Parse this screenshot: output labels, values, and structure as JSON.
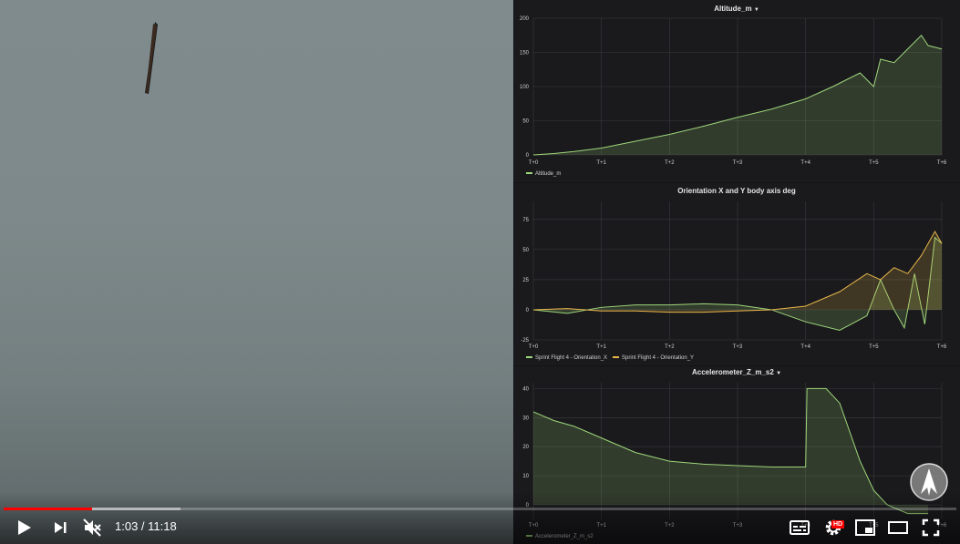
{
  "player": {
    "current_time": "1:03",
    "separator": " / ",
    "duration": "11:18",
    "played_fraction": 0.093,
    "buffered_fraction": 0.186,
    "hd_badge": "HD",
    "icons": [
      "play-icon",
      "next-icon",
      "mute-icon",
      "subtitles-icon",
      "settings-icon",
      "miniplayer-icon",
      "theater-icon",
      "fullscreen-icon"
    ]
  },
  "dashboard": {
    "colors": {
      "bg": "#1a1a1d",
      "grid": "#3a3a3f",
      "green": "#9ed67a",
      "yellow": "#e8b64a",
      "text": "#d0d0d0"
    },
    "panels": [
      {
        "title": "Altitude_m",
        "has_dropdown": true,
        "legend": [
          "Altitude_m"
        ]
      },
      {
        "title": "Orientation X and Y body axis deg",
        "has_dropdown": false,
        "legend": [
          "Sprint Flight 4 - Orientation_X",
          "Sprint Flight 4 - Orientation_Y"
        ]
      },
      {
        "title": "Accelerometer_Z_m_s2",
        "has_dropdown": true,
        "legend": [
          "Accelerometer_Z_m_s2"
        ]
      }
    ]
  },
  "chart_data": [
    {
      "type": "area",
      "title": "Altitude_m",
      "x_ticks": [
        "T+0",
        "T+1",
        "T+2",
        "T+3",
        "T+4",
        "T+5",
        "T+6"
      ],
      "ylim": [
        0,
        200
      ],
      "y_ticks": [
        0,
        50,
        100,
        150,
        200
      ],
      "grid": true,
      "legend_position": "bottom-left",
      "series": [
        {
          "name": "Altitude_m",
          "color": "#9ed67a",
          "x": [
            0,
            0.3,
            0.6,
            1.0,
            1.5,
            2.0,
            2.5,
            3.0,
            3.5,
            4.0,
            4.4,
            4.8,
            5.0,
            5.1,
            5.3,
            5.5,
            5.7,
            5.8,
            6.0
          ],
          "y": [
            0,
            2,
            5,
            10,
            20,
            30,
            42,
            55,
            67,
            82,
            100,
            120,
            100,
            140,
            135,
            155,
            175,
            160,
            155
          ]
        }
      ]
    },
    {
      "type": "area",
      "title": "Orientation X and Y body axis deg",
      "x_ticks": [
        "T+0",
        "T+1",
        "T+2",
        "T+3",
        "T+4",
        "T+5",
        "T+6"
      ],
      "ylim": [
        -25,
        90
      ],
      "y_ticks": [
        -25,
        0,
        25,
        50,
        75
      ],
      "grid": true,
      "legend_position": "bottom-left",
      "series": [
        {
          "name": "Sprint Flight 4 - Orientation_X",
          "color": "#9ed67a",
          "x": [
            0,
            0.5,
            1.0,
            1.5,
            2.0,
            2.5,
            3.0,
            3.5,
            4.0,
            4.5,
            4.9,
            5.1,
            5.3,
            5.45,
            5.6,
            5.75,
            5.9,
            6.0
          ],
          "y": [
            0,
            -3,
            2,
            4,
            4,
            5,
            4,
            0,
            -10,
            -17,
            -5,
            25,
            0,
            -15,
            30,
            -12,
            60,
            55
          ]
        },
        {
          "name": "Sprint Flight 4 - Orientation_Y",
          "color": "#e8b64a",
          "x": [
            0,
            0.5,
            1.0,
            1.5,
            2.0,
            2.5,
            3.0,
            3.5,
            4.0,
            4.5,
            4.9,
            5.1,
            5.3,
            5.5,
            5.7,
            5.9,
            6.0
          ],
          "y": [
            0,
            1,
            -1,
            -1,
            -2,
            -2,
            -1,
            0,
            3,
            15,
            30,
            25,
            35,
            30,
            45,
            65,
            55
          ]
        }
      ]
    },
    {
      "type": "area",
      "title": "Accelerometer_Z_m_s2",
      "x_ticks": [
        "T+0",
        "T+1",
        "T+2",
        "T+3",
        "T+4",
        "T+5",
        "T+6"
      ],
      "ylim": [
        -5,
        42
      ],
      "y_ticks": [
        0,
        10,
        20,
        30,
        40
      ],
      "grid": true,
      "legend_position": "bottom-left",
      "series": [
        {
          "name": "Accelerometer_Z_m_s2",
          "color": "#9ed67a",
          "x": [
            0,
            0.3,
            0.6,
            1.0,
            1.5,
            2.0,
            2.5,
            3.0,
            3.5,
            4.0,
            4.02,
            4.3,
            4.5,
            4.8,
            5.0,
            5.2,
            5.5,
            5.8
          ],
          "y": [
            32,
            29,
            27,
            23,
            18,
            15,
            14,
            13.5,
            13,
            13,
            40,
            40,
            35,
            15,
            5,
            0,
            -3,
            -3
          ]
        }
      ]
    }
  ]
}
